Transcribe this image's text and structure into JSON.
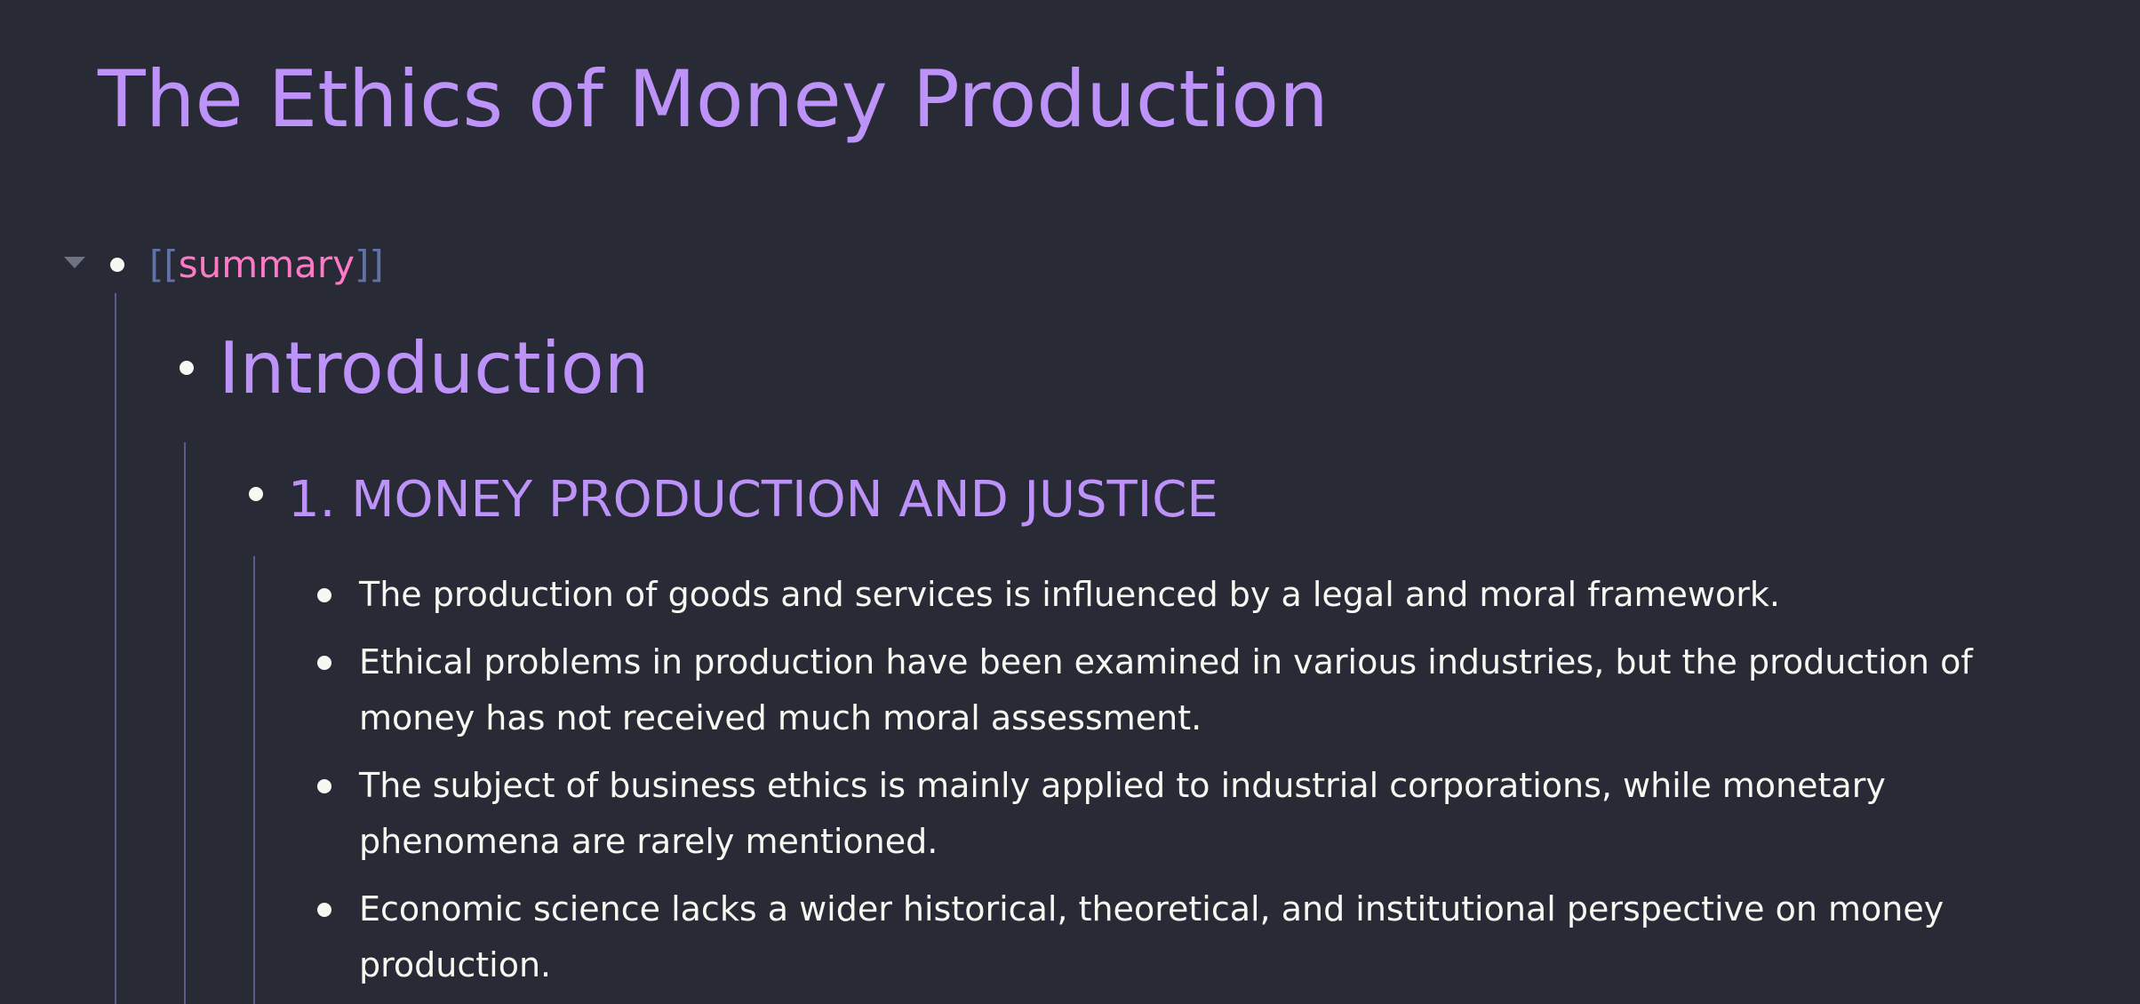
{
  "page": {
    "title": "The Ethics of Money Production"
  },
  "outline": {
    "root": {
      "bracket_open": "[[",
      "label": "summary",
      "bracket_close": "]]",
      "collapsed": false
    },
    "heading": "Introduction",
    "section": {
      "heading": "1. MONEY PRODUCTION AND JUSTICE",
      "items": [
        "The production of goods and services is influenced by a legal and moral framework.",
        "Ethical problems in production have been examined in various industries, but the production of money has not received much moral assessment.",
        "The subject of business ethics is mainly applied to industrial corporations, while monetary phenomena are rarely mentioned.",
        "Economic science lacks a wider historical, theoretical, and institutional perspective on money production."
      ]
    }
  },
  "theme": {
    "background": "#282a36",
    "heading_color": "#bd93f9",
    "link_color": "#ff79c6",
    "bracket_color": "#6272a4",
    "text_color": "#f8f8f2",
    "guide_color": "#5a5d8a",
    "toggle_icon": "caret-down-icon"
  }
}
